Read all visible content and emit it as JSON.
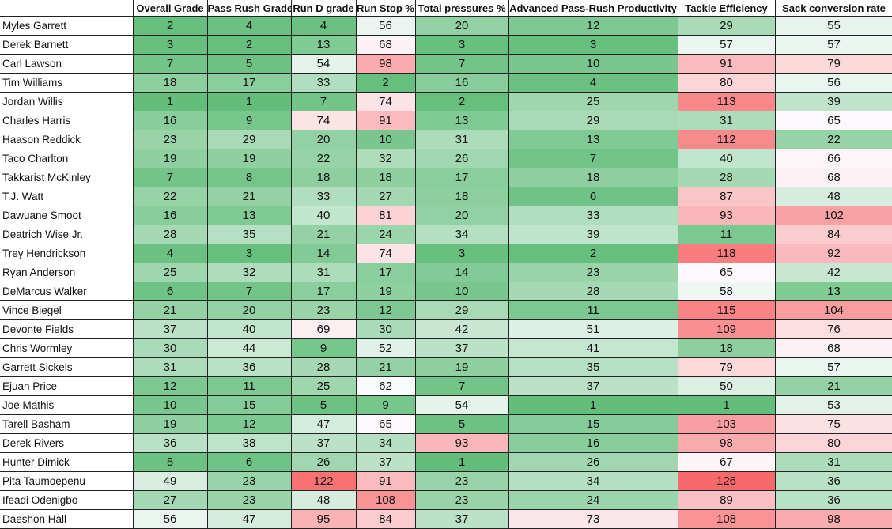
{
  "sheet": {
    "columns": [
      "",
      "Overall Grade",
      "Pass Rush Grade",
      "Run D grade",
      "Run Stop %",
      "Total pressures %",
      "Advanced Pass-Rush Productivity",
      "Tackle Efficiency",
      "Sack conversion rate"
    ],
    "color_scale": {
      "low": "#63BE7B",
      "mid": "#FCFCFF",
      "high": "#F8696B"
    },
    "rows": [
      {
        "name": "Myles Garrett",
        "values": [
          2,
          4,
          4,
          56,
          20,
          12,
          29,
          55
        ]
      },
      {
        "name": "Derek Barnett",
        "values": [
          3,
          2,
          13,
          68,
          3,
          3,
          57,
          57
        ]
      },
      {
        "name": "Carl Lawson",
        "values": [
          7,
          5,
          54,
          98,
          7,
          10,
          91,
          79
        ]
      },
      {
        "name": "Tim Williams",
        "values": [
          18,
          17,
          33,
          2,
          16,
          4,
          80,
          56
        ]
      },
      {
        "name": "Jordan Willis",
        "values": [
          1,
          1,
          7,
          74,
          2,
          25,
          113,
          39
        ]
      },
      {
        "name": "Charles Harris",
        "values": [
          16,
          9,
          74,
          91,
          13,
          29,
          31,
          65
        ]
      },
      {
        "name": "Haason Reddick",
        "values": [
          23,
          29,
          20,
          10,
          31,
          13,
          112,
          22
        ]
      },
      {
        "name": "Taco Charlton",
        "values": [
          19,
          19,
          22,
          32,
          26,
          7,
          40,
          66
        ]
      },
      {
        "name": "Takkarist McKinley",
        "values": [
          7,
          8,
          18,
          18,
          17,
          18,
          28,
          68
        ]
      },
      {
        "name": "T.J. Watt",
        "values": [
          22,
          21,
          33,
          27,
          18,
          6,
          87,
          48
        ]
      },
      {
        "name": "Dawuane Smoot",
        "values": [
          16,
          13,
          40,
          81,
          20,
          33,
          93,
          102
        ]
      },
      {
        "name": "Deatrich Wise Jr.",
        "values": [
          28,
          35,
          21,
          24,
          34,
          39,
          11,
          84
        ]
      },
      {
        "name": "Trey Hendrickson",
        "values": [
          4,
          3,
          14,
          74,
          3,
          2,
          118,
          92
        ]
      },
      {
        "name": "Ryan Anderson",
        "values": [
          25,
          32,
          31,
          17,
          14,
          23,
          65,
          42
        ]
      },
      {
        "name": "DeMarcus Walker",
        "values": [
          6,
          7,
          17,
          19,
          10,
          28,
          58,
          13
        ]
      },
      {
        "name": "Vince Biegel",
        "values": [
          21,
          20,
          23,
          12,
          29,
          11,
          115,
          104
        ]
      },
      {
        "name": "Devonte Fields",
        "values": [
          37,
          40,
          69,
          30,
          42,
          51,
          109,
          76
        ]
      },
      {
        "name": "Chris Wormley",
        "values": [
          30,
          44,
          9,
          52,
          37,
          41,
          18,
          68
        ]
      },
      {
        "name": "Garrett Sickels",
        "values": [
          31,
          36,
          28,
          21,
          19,
          35,
          79,
          57
        ]
      },
      {
        "name": "Ejuan Price",
        "values": [
          12,
          11,
          25,
          62,
          7,
          37,
          50,
          21
        ]
      },
      {
        "name": "Joe Mathis",
        "values": [
          10,
          15,
          5,
          9,
          54,
          1,
          1,
          53
        ]
      },
      {
        "name": "Tarell Basham",
        "values": [
          19,
          12,
          47,
          65,
          5,
          15,
          103,
          75
        ]
      },
      {
        "name": "Derek Rivers",
        "values": [
          36,
          38,
          37,
          34,
          93,
          16,
          98,
          80
        ]
      },
      {
        "name": "Hunter Dimick",
        "values": [
          5,
          6,
          26,
          37,
          1,
          26,
          67,
          31
        ]
      },
      {
        "name": "Pita Taumoepenu",
        "values": [
          49,
          23,
          122,
          91,
          23,
          34,
          126,
          36
        ]
      },
      {
        "name": "Ifeadi Odenigbo",
        "values": [
          27,
          23,
          48,
          108,
          23,
          24,
          89,
          36
        ]
      },
      {
        "name": "Daeshon Hall",
        "values": [
          56,
          47,
          95,
          84,
          37,
          73,
          108,
          98
        ]
      }
    ]
  }
}
